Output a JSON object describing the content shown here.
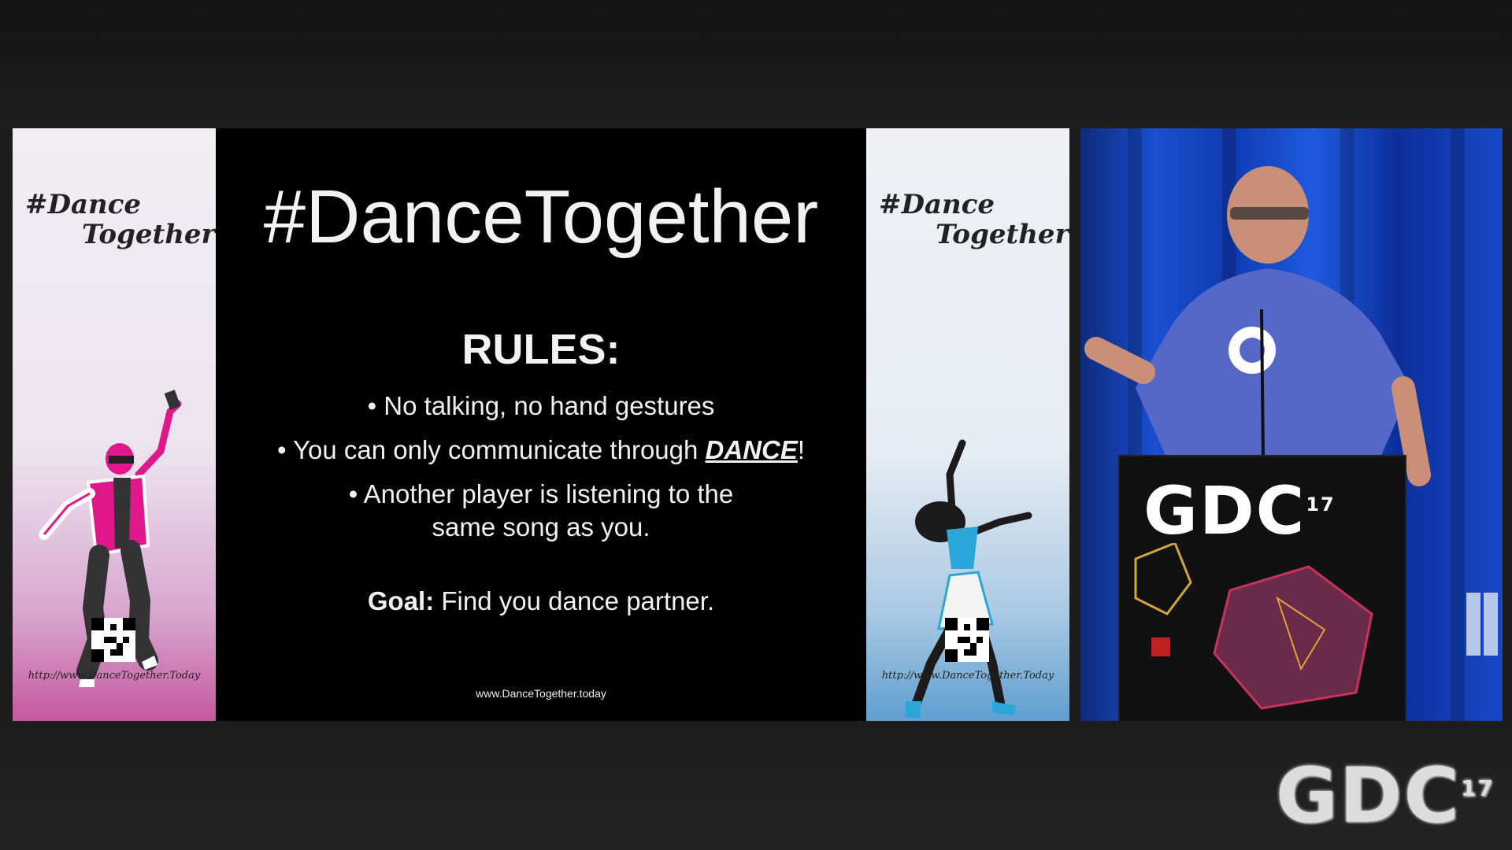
{
  "slide": {
    "banner_left": {
      "title_line1": "#Dance",
      "title_line2": "Together",
      "url": "http://www.DanceTogether.Today",
      "accent": "#e0168b"
    },
    "banner_right": {
      "title_line1": "#Dance",
      "title_line2": "Together",
      "url": "http://www.DanceTogether.Today",
      "accent": "#2aa7d8"
    },
    "title": "#DanceTogether",
    "rules_heading": "RULES:",
    "rules": [
      "• No talking, no hand gestures",
      "• You can only communicate through ",
      "• Another player is listening to the",
      "same song as you."
    ],
    "rule2_emphasis": "DANCE",
    "rule2_suffix": "!",
    "goal_label": "Goal:",
    "goal_text": " Find you dance partner.",
    "website": "www.DanceTogether.today"
  },
  "video": {
    "podium_logo": "GDC",
    "podium_logo_badge": "17"
  },
  "overlay_logo": "GDC",
  "overlay_logo_badge": "17"
}
